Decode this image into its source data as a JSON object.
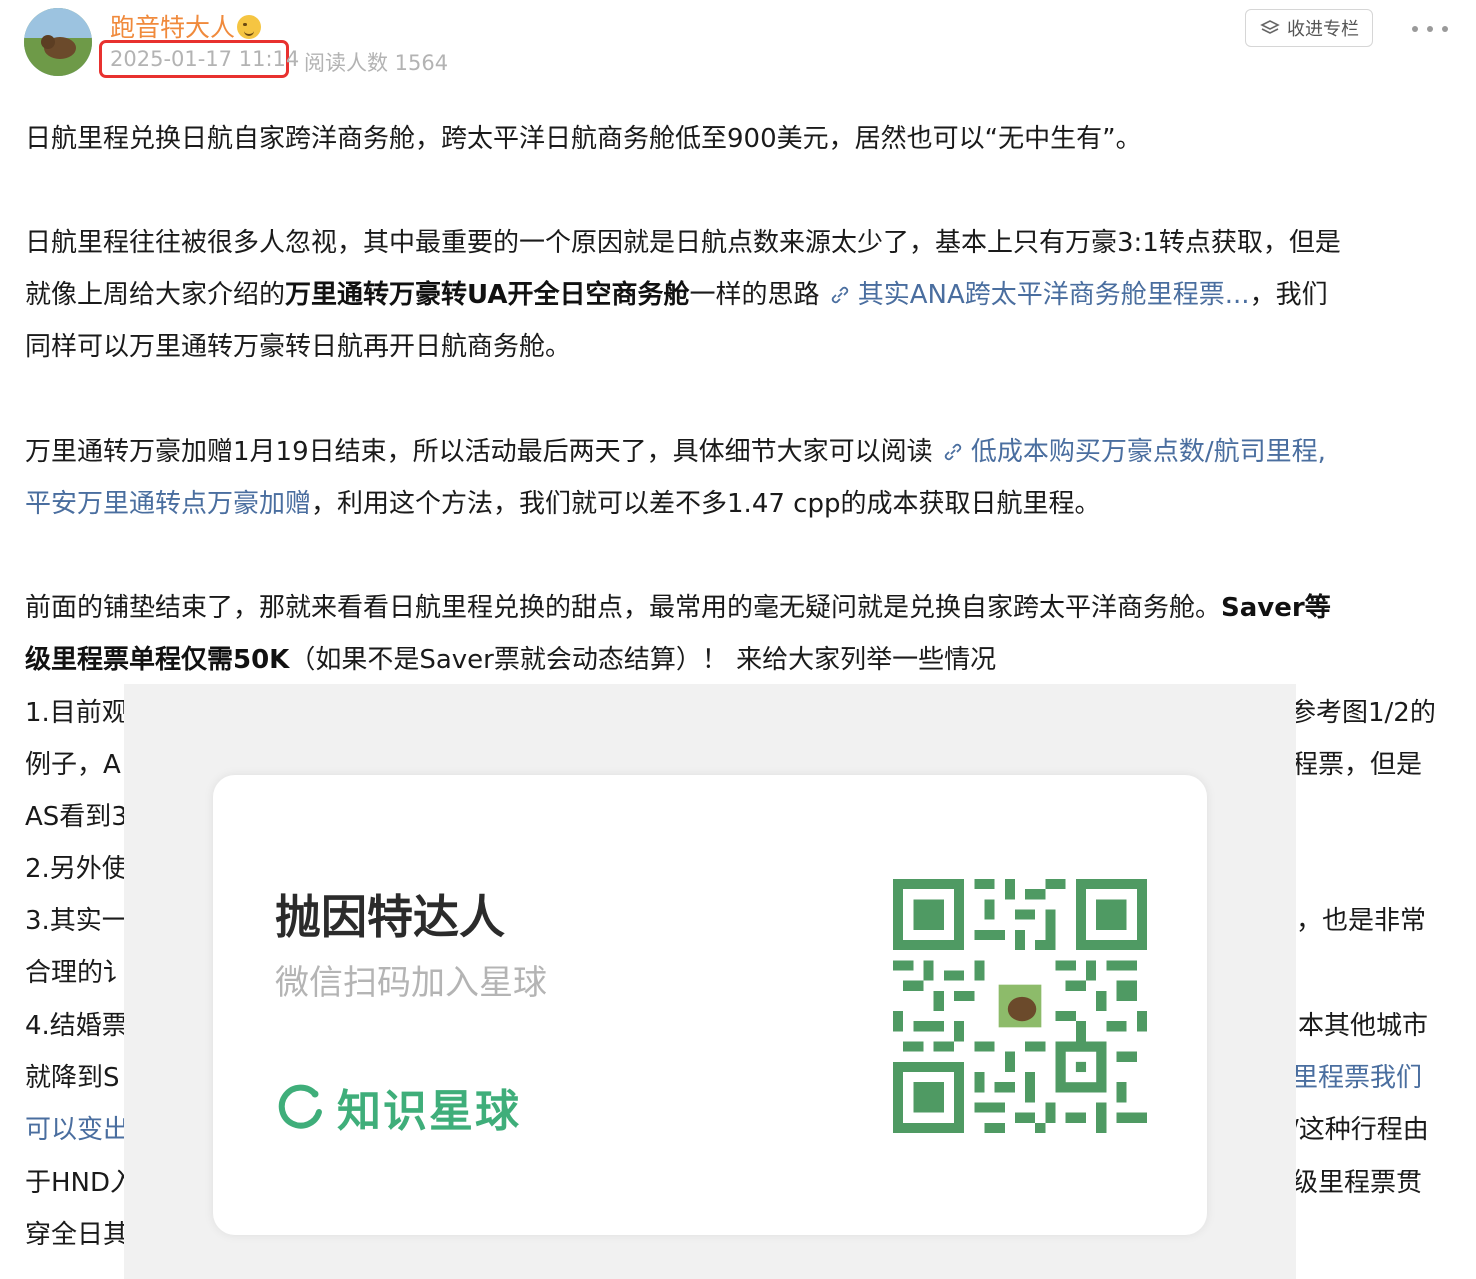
{
  "header": {
    "author": "跑音特大人",
    "date": "2025-01-17 11:14",
    "reads": "阅读人数 1564",
    "collect_label": "收进专栏"
  },
  "paragraphs": {
    "p1": "日航里程兑换日航自家跨洋商务舱，跨太平洋日航商务舱低至900美元，居然也可以“无中生有”。",
    "p2_l1": "日航里程往往被很多人忽视，其中最重要的一个原因就是日航点数来源太少了，基本上只有万豪3:1转点获取，但是",
    "p2_l2_a": "就像上周给大家介绍的",
    "p2_l2_bold": "万里通转万豪转UA开全日空商务舱",
    "p2_l2_b": "一样的思路",
    "p2_l2_link": "其实ANA跨太平洋商务舱里程票...",
    "p2_l2_c": "，我们",
    "p2_l3": "同样可以万里通转万豪转日航再开日航商务舱。",
    "p3_l1_a": "万里通转万豪加赠1月19日结束，所以活动最后两天了，具体细节大家可以阅读",
    "p3_l1_link": "低成本购买万豪点数/航司里程,",
    "p3_l2_link": "平安万里通转点万豪加赠",
    "p3_l2_a": "，利用这个方法，我们就可以差不多1.47 cpp的成本获取日航里程。",
    "p4_l1_a": "前面的铺垫结束了，那就来看看日航里程兑换的甜点，最常用的毫无疑问就是兑换自家跨太平洋商务舱。",
    "p4_l1_bold": "Saver等",
    "p4_l2_bold": "级里程票单程仅需50K",
    "p4_l2_a": "（如果不是Saver票就会动态结算）！ 来给大家列举一些情况"
  },
  "partial_lines": {
    "l1_left": "1.目前观",
    "l1_right": "参考图1/2的",
    "l2_left": "例子，A",
    "l2_right": "程票，但是",
    "l3_left": "AS看到3",
    "l4_left": "2.另外使",
    "l5_left": "3.其实一",
    "l5_right": "，也是非常",
    "l6_left": "合理的讠",
    "l7_left": "4.结婚票",
    "l7_right": "本其他城市",
    "l8_left": "就降到S",
    "l8_right": "里程票我们",
    "l9_left": "可以变出",
    "l9_right": "/这种行程由",
    "l10_left": "于HND入",
    "l10_right": "级里程票贯",
    "l11_left": "穿全日其"
  },
  "card": {
    "title": "抛因特达人",
    "subtitle": "微信扫码加入星球",
    "brand": "知识星球"
  },
  "colors": {
    "author": "#f08a3c",
    "link": "#4a6e9f",
    "highlight_box": "#e8312f",
    "brand_green": "#3fae7a",
    "qr_green": "#4f9a63"
  }
}
